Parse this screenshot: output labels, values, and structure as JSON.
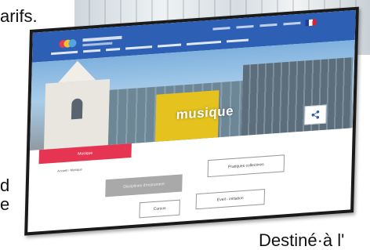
{
  "background_text": {
    "top": "arifs.",
    "left_line1": "d",
    "left_line2": "e",
    "bottom": "Destiné·à l'"
  },
  "website": {
    "hero_title": "musique",
    "tab_label": "Musique",
    "breadcrumb": "Accueil › Musique",
    "buttons": {
      "disciplines": "Disciplines d'instrument",
      "pratiques": "Pratiques collectives",
      "cursus": "Cursus",
      "eveil": "Eveil - initiation"
    },
    "share_icon": "share-icon"
  },
  "colors": {
    "topbar": "#2d5fb4",
    "tab_accent": "#e63552",
    "hero_yellow": "#e5c21e",
    "button_grey": "#a9a9a9"
  }
}
